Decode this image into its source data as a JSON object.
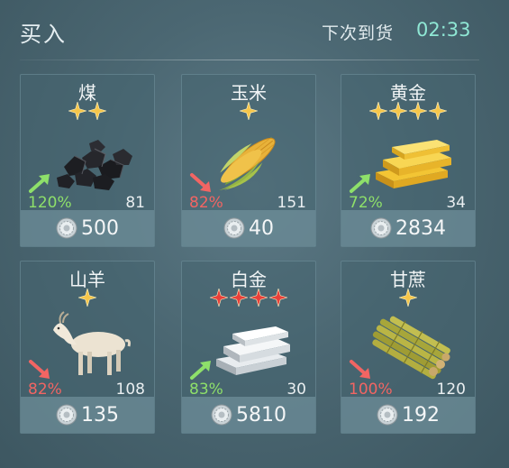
{
  "header": {
    "title": "买入",
    "restock_label": "下次到货",
    "restock_time": "02:33"
  },
  "colors": {
    "accent_time": "#8fe7d4",
    "trend_up": "#8ee06a",
    "trend_down": "#f26563",
    "star_gold": "#f6c64a",
    "star_red": "#e8403a"
  },
  "items": [
    {
      "name": "煤",
      "stars": 2,
      "star_color": "gold",
      "icon": "coal-icon",
      "trend": "up",
      "percent": "120%",
      "stock": "81",
      "price": "500"
    },
    {
      "name": "玉米",
      "stars": 1,
      "star_color": "gold",
      "icon": "corn-icon",
      "trend": "down",
      "percent": "82%",
      "stock": "151",
      "price": "40"
    },
    {
      "name": "黄金",
      "stars": 4,
      "star_color": "gold",
      "icon": "gold-bar-icon",
      "trend": "up",
      "percent": "72%",
      "stock": "34",
      "price": "2834"
    },
    {
      "name": "山羊",
      "stars": 1,
      "star_color": "gold",
      "icon": "goat-icon",
      "trend": "down",
      "percent": "82%",
      "stock": "108",
      "price": "135"
    },
    {
      "name": "白金",
      "stars": 4,
      "star_color": "red",
      "icon": "platinum-bar-icon",
      "trend": "up",
      "percent": "83%",
      "stock": "30",
      "price": "5810"
    },
    {
      "name": "甘蔗",
      "stars": 1,
      "star_color": "gold",
      "icon": "sugarcane-icon",
      "trend": "down",
      "percent": "100%",
      "stock": "120",
      "price": "192"
    }
  ]
}
